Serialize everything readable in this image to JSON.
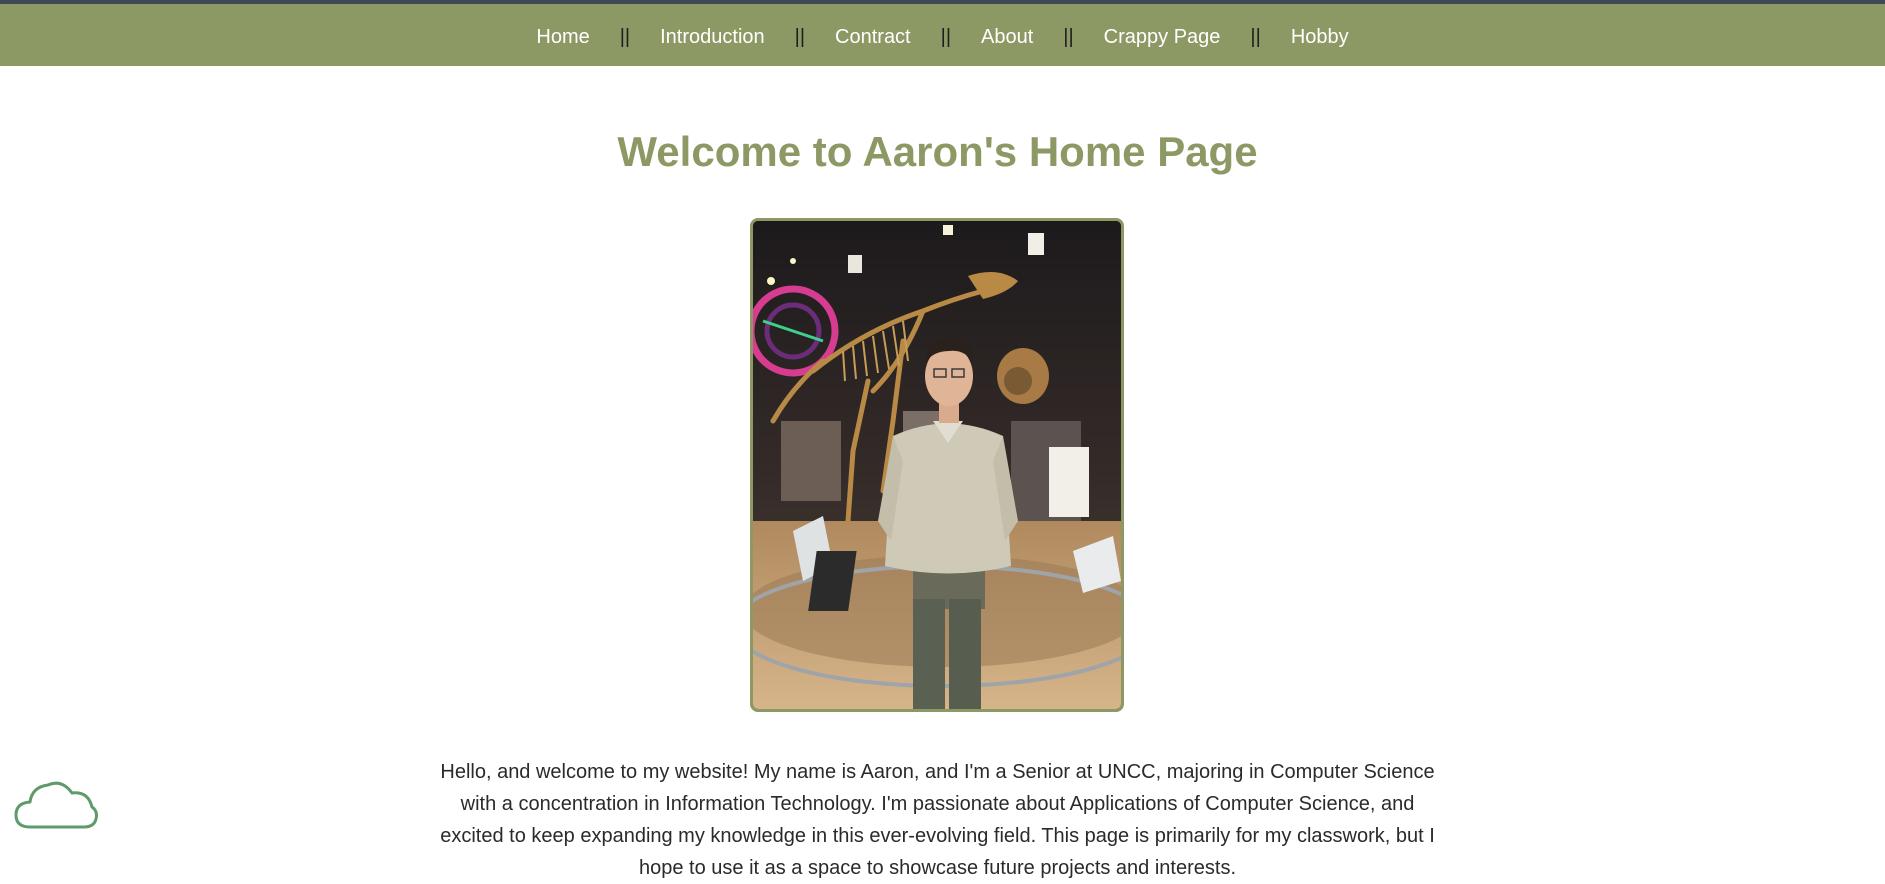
{
  "nav": {
    "items": [
      {
        "label": "Home"
      },
      {
        "label": "Introduction"
      },
      {
        "label": "Contract"
      },
      {
        "label": "About"
      },
      {
        "label": "Crappy Page"
      },
      {
        "label": "Hobby"
      }
    ],
    "separator": "||"
  },
  "main": {
    "title": "Welcome to Aaron's Home Page",
    "photo_icon": "profile-photo",
    "intro": "Hello, and welcome to my website! My name is Aaron, and I'm a Senior at UNCC, majoring in Computer Science with a concentration in Information Technology. I'm passionate about Applications of Computer Science, and excited to keep expanding my knowledge in this ever-evolving field. This page is primarily for my classwork, but I hope to use it as a space to showcase future projects and interests."
  },
  "floating": {
    "icon": "cloud-icon"
  },
  "colors": {
    "accent": "#8c9964",
    "topBorder": "#3d4a55",
    "cloud": "#5f9a6a",
    "text": "#2a2a2a"
  }
}
